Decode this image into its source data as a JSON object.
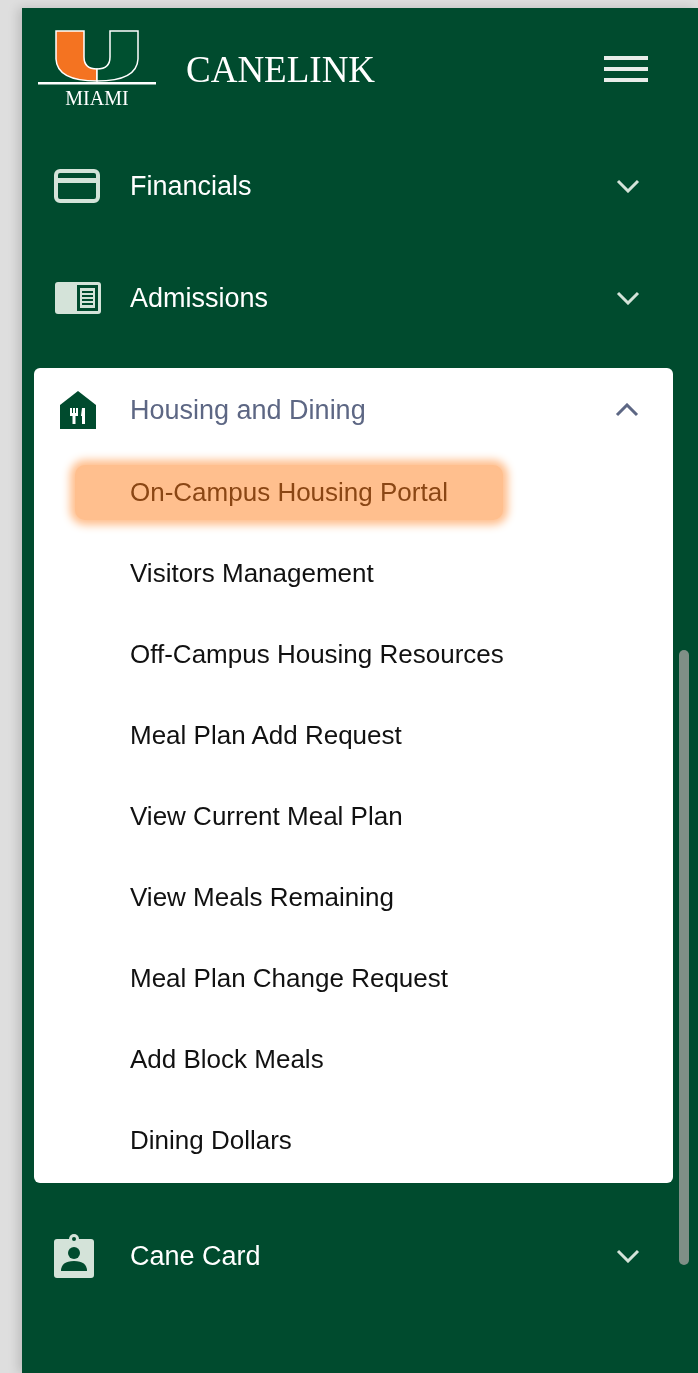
{
  "header": {
    "logo_text": "MIAMI",
    "title": "CANELINK"
  },
  "menu": [
    {
      "label": "Financials",
      "expanded": false
    },
    {
      "label": "Admissions",
      "expanded": false
    },
    {
      "label": "Housing and Dining",
      "expanded": true,
      "children": [
        {
          "label": "On-Campus Housing Portal",
          "selected": true
        },
        {
          "label": "Visitors Management",
          "selected": false
        },
        {
          "label": "Off-Campus Housing Resources",
          "selected": false
        },
        {
          "label": "Meal Plan Add Request",
          "selected": false
        },
        {
          "label": "View Current Meal Plan",
          "selected": false
        },
        {
          "label": "View Meals Remaining",
          "selected": false
        },
        {
          "label": "Meal Plan Change Request",
          "selected": false
        },
        {
          "label": "Add Block Meals",
          "selected": false
        },
        {
          "label": "Dining Dollars",
          "selected": false
        }
      ]
    },
    {
      "label": "Cane Card",
      "expanded": false
    }
  ]
}
